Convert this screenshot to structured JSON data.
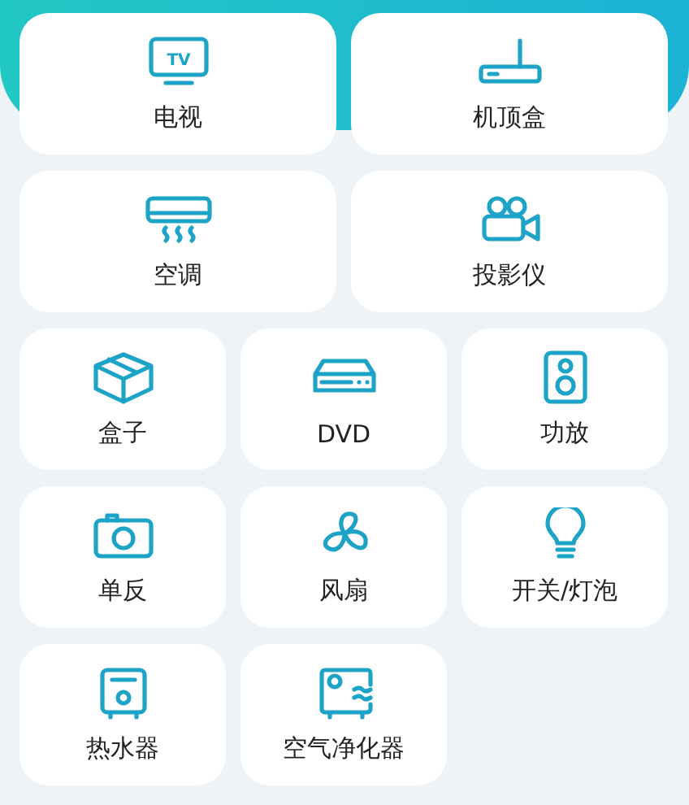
{
  "device_rows": [
    [
      {
        "kind": "tv",
        "label": "电视",
        "icon_text": "TV"
      },
      {
        "kind": "settop",
        "label": "机顶盒"
      }
    ],
    [
      {
        "kind": "ac",
        "label": "空调"
      },
      {
        "kind": "projector",
        "label": "投影仪"
      }
    ],
    [
      {
        "kind": "box",
        "label": "盒子"
      },
      {
        "kind": "dvd",
        "label": "DVD"
      },
      {
        "kind": "speaker",
        "label": "功放"
      }
    ],
    [
      {
        "kind": "camera",
        "label": "单反"
      },
      {
        "kind": "fan",
        "label": "风扇"
      },
      {
        "kind": "bulb",
        "label": "开关/灯泡"
      }
    ],
    [
      {
        "kind": "heater",
        "label": "热水器"
      },
      {
        "kind": "purifier",
        "label": "空气净化器"
      }
    ]
  ]
}
